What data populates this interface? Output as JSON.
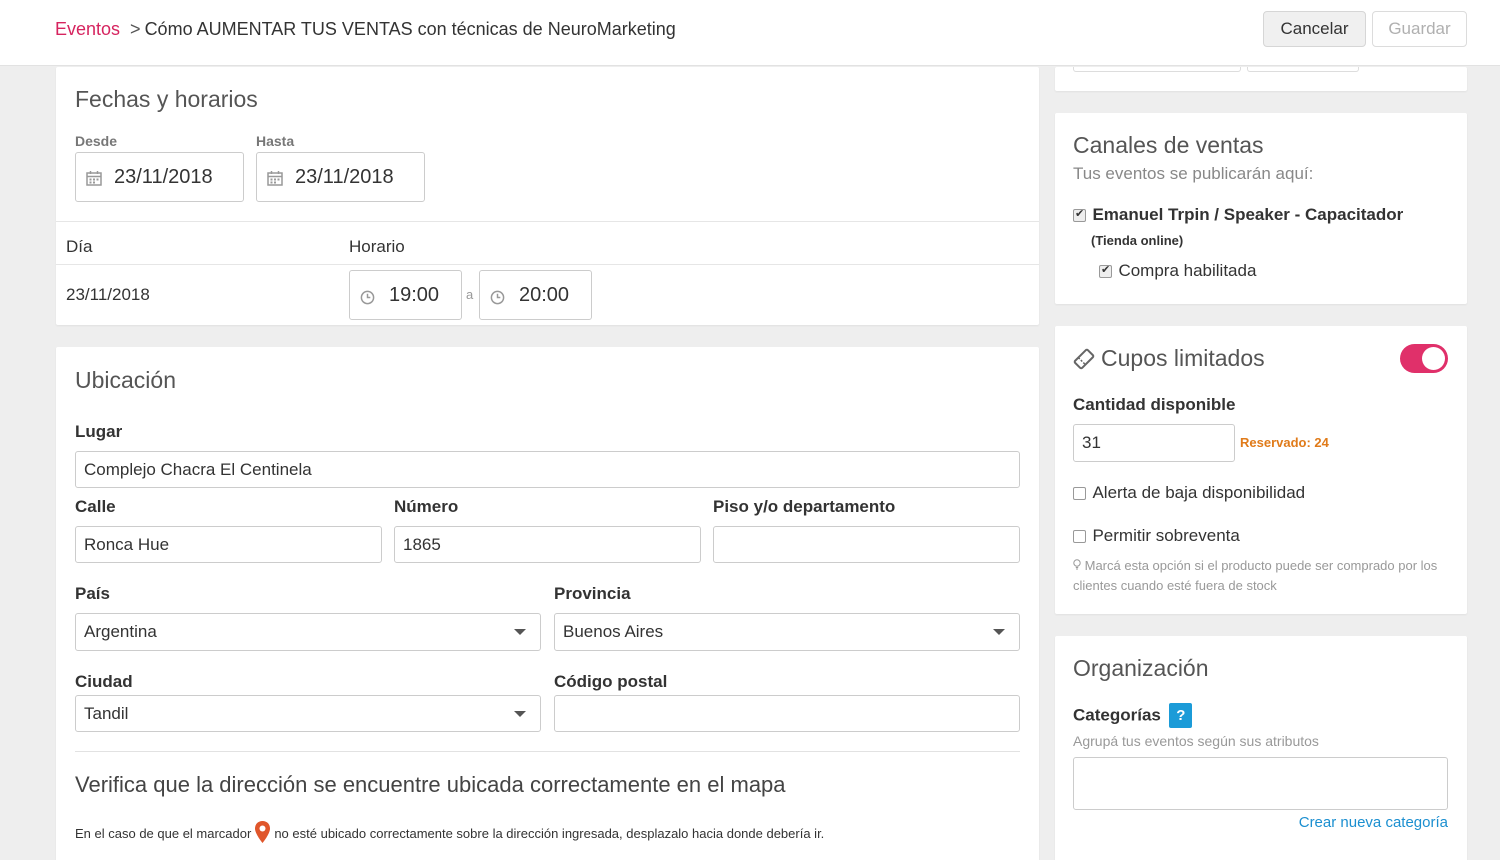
{
  "header": {
    "breadcrumb_link": "Eventos",
    "breadcrumb_separator": ">",
    "breadcrumb_current": "Cómo AUMENTAR TUS VENTAS con técnicas de NeuroMarketing",
    "cancel_label": "Cancelar",
    "save_label": "Guardar"
  },
  "dates": {
    "title": "Fechas y horarios",
    "from_label": "Desde",
    "from_value": "23/11/2018",
    "to_label": "Hasta",
    "to_value": "23/11/2018",
    "col_day": "Día",
    "col_time": "Horario",
    "row_day": "23/11/2018",
    "start_time": "19:00",
    "time_sep": "a",
    "end_time": "20:00"
  },
  "location": {
    "title": "Ubicación",
    "place_label": "Lugar",
    "place_value": "Complejo Chacra El Centinela",
    "street_label": "Calle",
    "street_value": "Ronca Hue",
    "number_label": "Número",
    "number_value": "1865",
    "floor_label": "Piso y/o departamento",
    "floor_value": "",
    "country_label": "País",
    "country_value": "Argentina",
    "province_label": "Provincia",
    "province_value": "Buenos Aires",
    "city_label": "Ciudad",
    "city_value": "Tandil",
    "zip_label": "Código postal",
    "zip_value": "",
    "map_title": "Verifica que la dirección se encuentre ubicada correctamente en el mapa",
    "map_hint_before": "En el caso de que el marcador",
    "map_hint_after": "no esté ubicado correctamente sobre la dirección ingresada, desplazalo hacia donde debería ir."
  },
  "channels": {
    "title": "Canales de ventas",
    "subtitle": "Tus eventos se publicarán aquí:",
    "store_name": "Emanuel Trpin / Speaker - Capacitador",
    "store_type": "(Tienda online)",
    "purchase_label": "Compra habilitada"
  },
  "quota": {
    "title": "Cupos limitados",
    "enabled": true,
    "qty_label": "Cantidad disponible",
    "qty_value": "31",
    "reserved": "Reservado: 24",
    "low_alert_label": "Alerta de baja disponibilidad",
    "oversell_label": "Permitir sobreventa",
    "oversell_hint": "Marcá esta opción si el producto puede ser comprado por los clientes cuando esté fuera de stock"
  },
  "organization": {
    "title": "Organización",
    "categories_label": "Categorías",
    "help_icon": "?",
    "categories_hint": "Agrupá tus eventos según sus atributos",
    "new_category_link": "Crear nueva categoría"
  },
  "colors": {
    "accent": "#d6245f",
    "toggle_on": "#e0306a",
    "reserved": "#e07b1a",
    "link": "#1b8fd0",
    "help_badge": "#1b9bd8",
    "map_pin": "#e0562b"
  }
}
